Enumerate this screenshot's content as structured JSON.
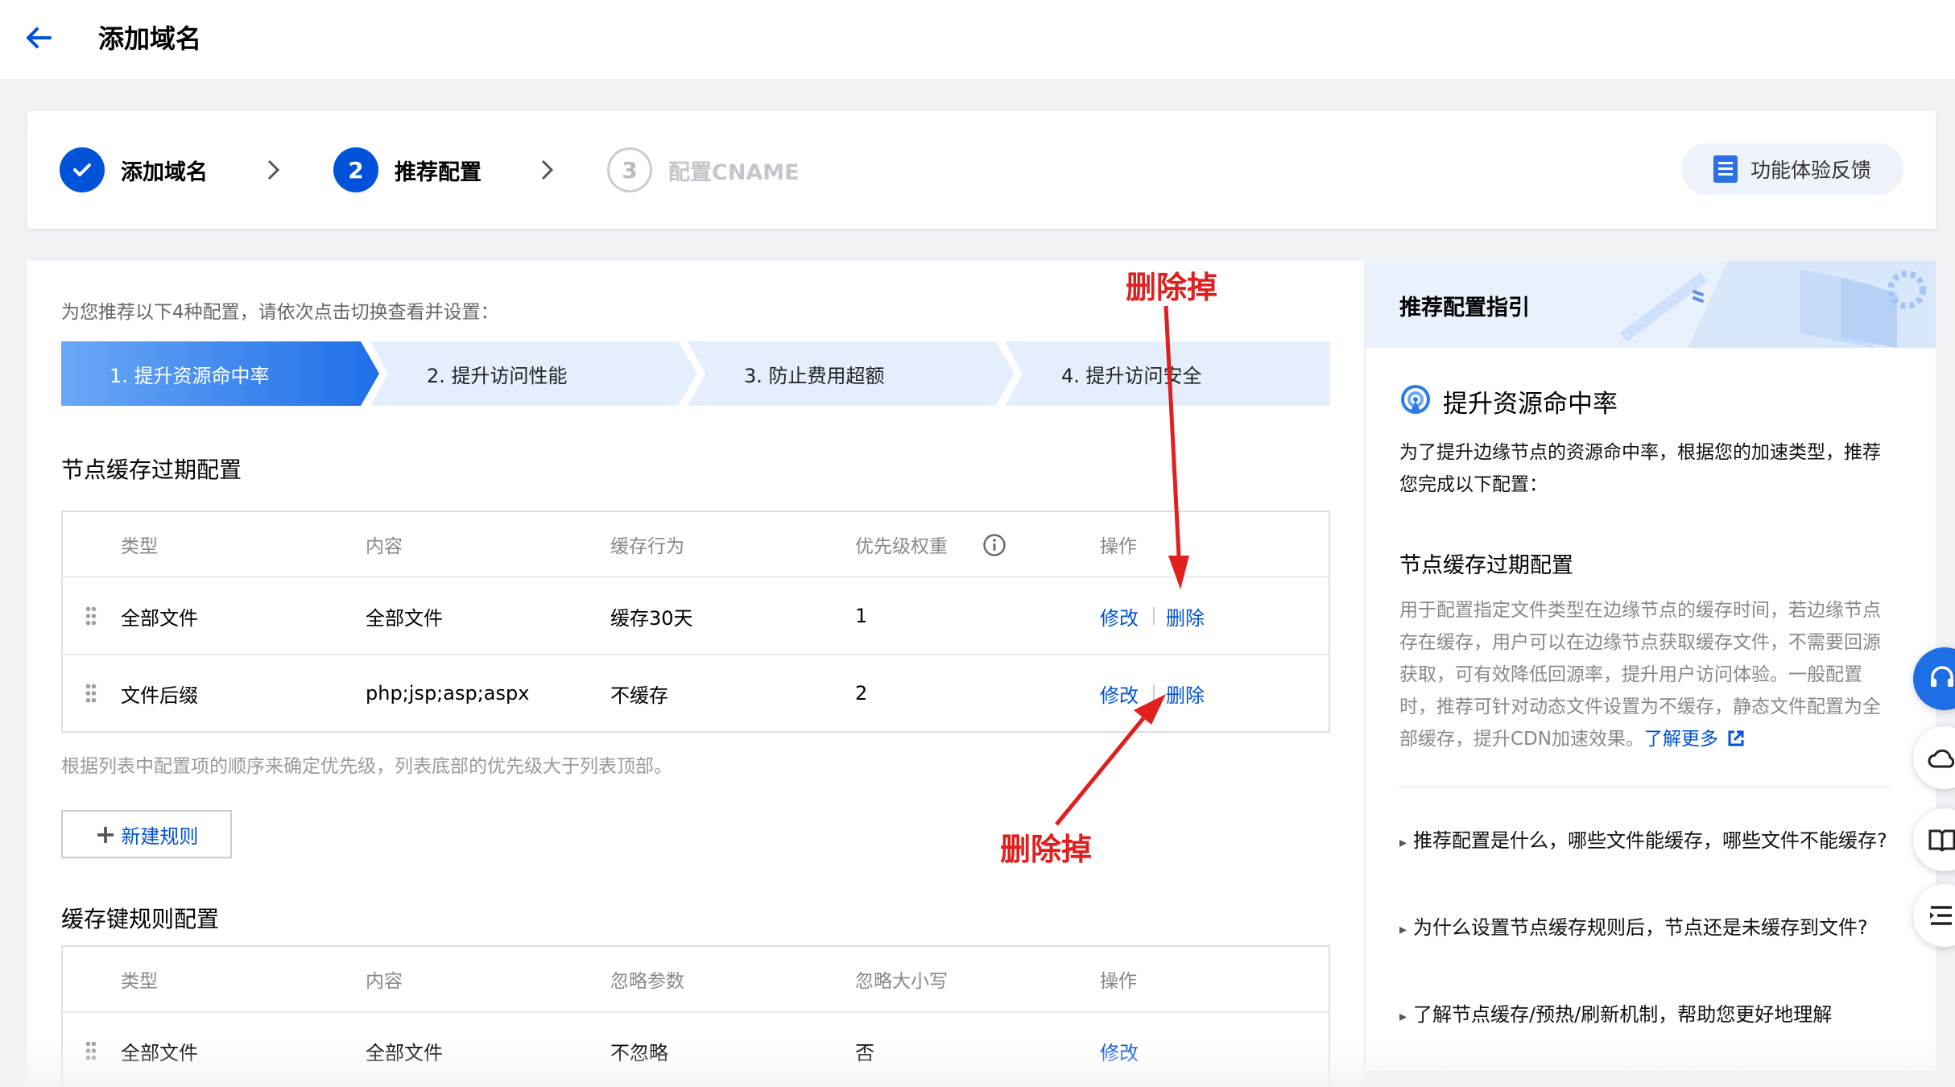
{
  "header": {
    "title": "添加域名"
  },
  "steps": [
    {
      "label": "添加域名",
      "state": "done"
    },
    {
      "label": "推荐配置",
      "number": "2",
      "state": "active"
    },
    {
      "label": "配置CNAME",
      "number": "3",
      "state": "pending"
    }
  ],
  "feedback": {
    "label": "功能体验反馈"
  },
  "main": {
    "intro": "为您推荐以下4种配置，请依次点击切换查看并设置：",
    "tabs": [
      {
        "label": "1. 提升资源命中率",
        "active": true
      },
      {
        "label": "2. 提升访问性能"
      },
      {
        "label": "3. 防止费用超额"
      },
      {
        "label": "4. 提升访问安全"
      }
    ],
    "cache_section": {
      "title": "节点缓存过期配置",
      "columns": [
        "类型",
        "内容",
        "缓存行为",
        "优先级权重",
        "操作"
      ],
      "rows": [
        {
          "type": "全部文件",
          "content": "全部文件",
          "behavior": "缓存30天",
          "priority": "1",
          "edit": "修改",
          "delete": "删除"
        },
        {
          "type": "文件后缀",
          "content": "php;jsp;asp;aspx",
          "behavior": "不缓存",
          "priority": "2",
          "edit": "修改",
          "delete": "删除"
        }
      ],
      "note": "根据列表中配置项的顺序来确定优先级，列表底部的优先级大于列表顶部。",
      "new_rule": "新建规则"
    },
    "key_section": {
      "title": "缓存键规则配置",
      "columns": [
        "类型",
        "内容",
        "忽略参数",
        "忽略大小写",
        "操作"
      ],
      "rows": [
        {
          "type": "全部文件",
          "content": "全部文件",
          "ignore_params": "不忽略",
          "ignore_case": "否",
          "edit": "修改"
        }
      ]
    }
  },
  "guide": {
    "title": "推荐配置指引",
    "section": "提升资源命中率",
    "section_desc": "为了提升边缘节点的资源命中率，根据您的加速类型，推荐您完成以下配置：",
    "sub_title": "节点缓存过期配置",
    "sub_desc": "用于配置指定文件类型在边缘节点的缓存时间，若边缘节点存在缓存，用户可以在边缘节点获取缓存文件，不需要回源获取，可有效降低回源率，提升用户访问体验。一般配置时，推荐可针对动态文件设置为不缓存，静态文件配置为全部缓存，提升CDN加速效果。",
    "learn_more": "了解更多",
    "faqs": [
      "推荐配置是什么，哪些文件能缓存，哪些文件不能缓存?",
      "为什么设置节点缓存规则后，节点还是未缓存到文件?",
      "了解节点缓存/预热/刷新机制，帮助您更好地理解"
    ]
  },
  "annotations": {
    "top": "删除掉",
    "bottom": "删除掉",
    "color": "#e01f1f"
  },
  "colors": {
    "primary": "#0052d9",
    "tab_inactive": "#e4eefc",
    "page_bg": "#f0f2f5"
  }
}
